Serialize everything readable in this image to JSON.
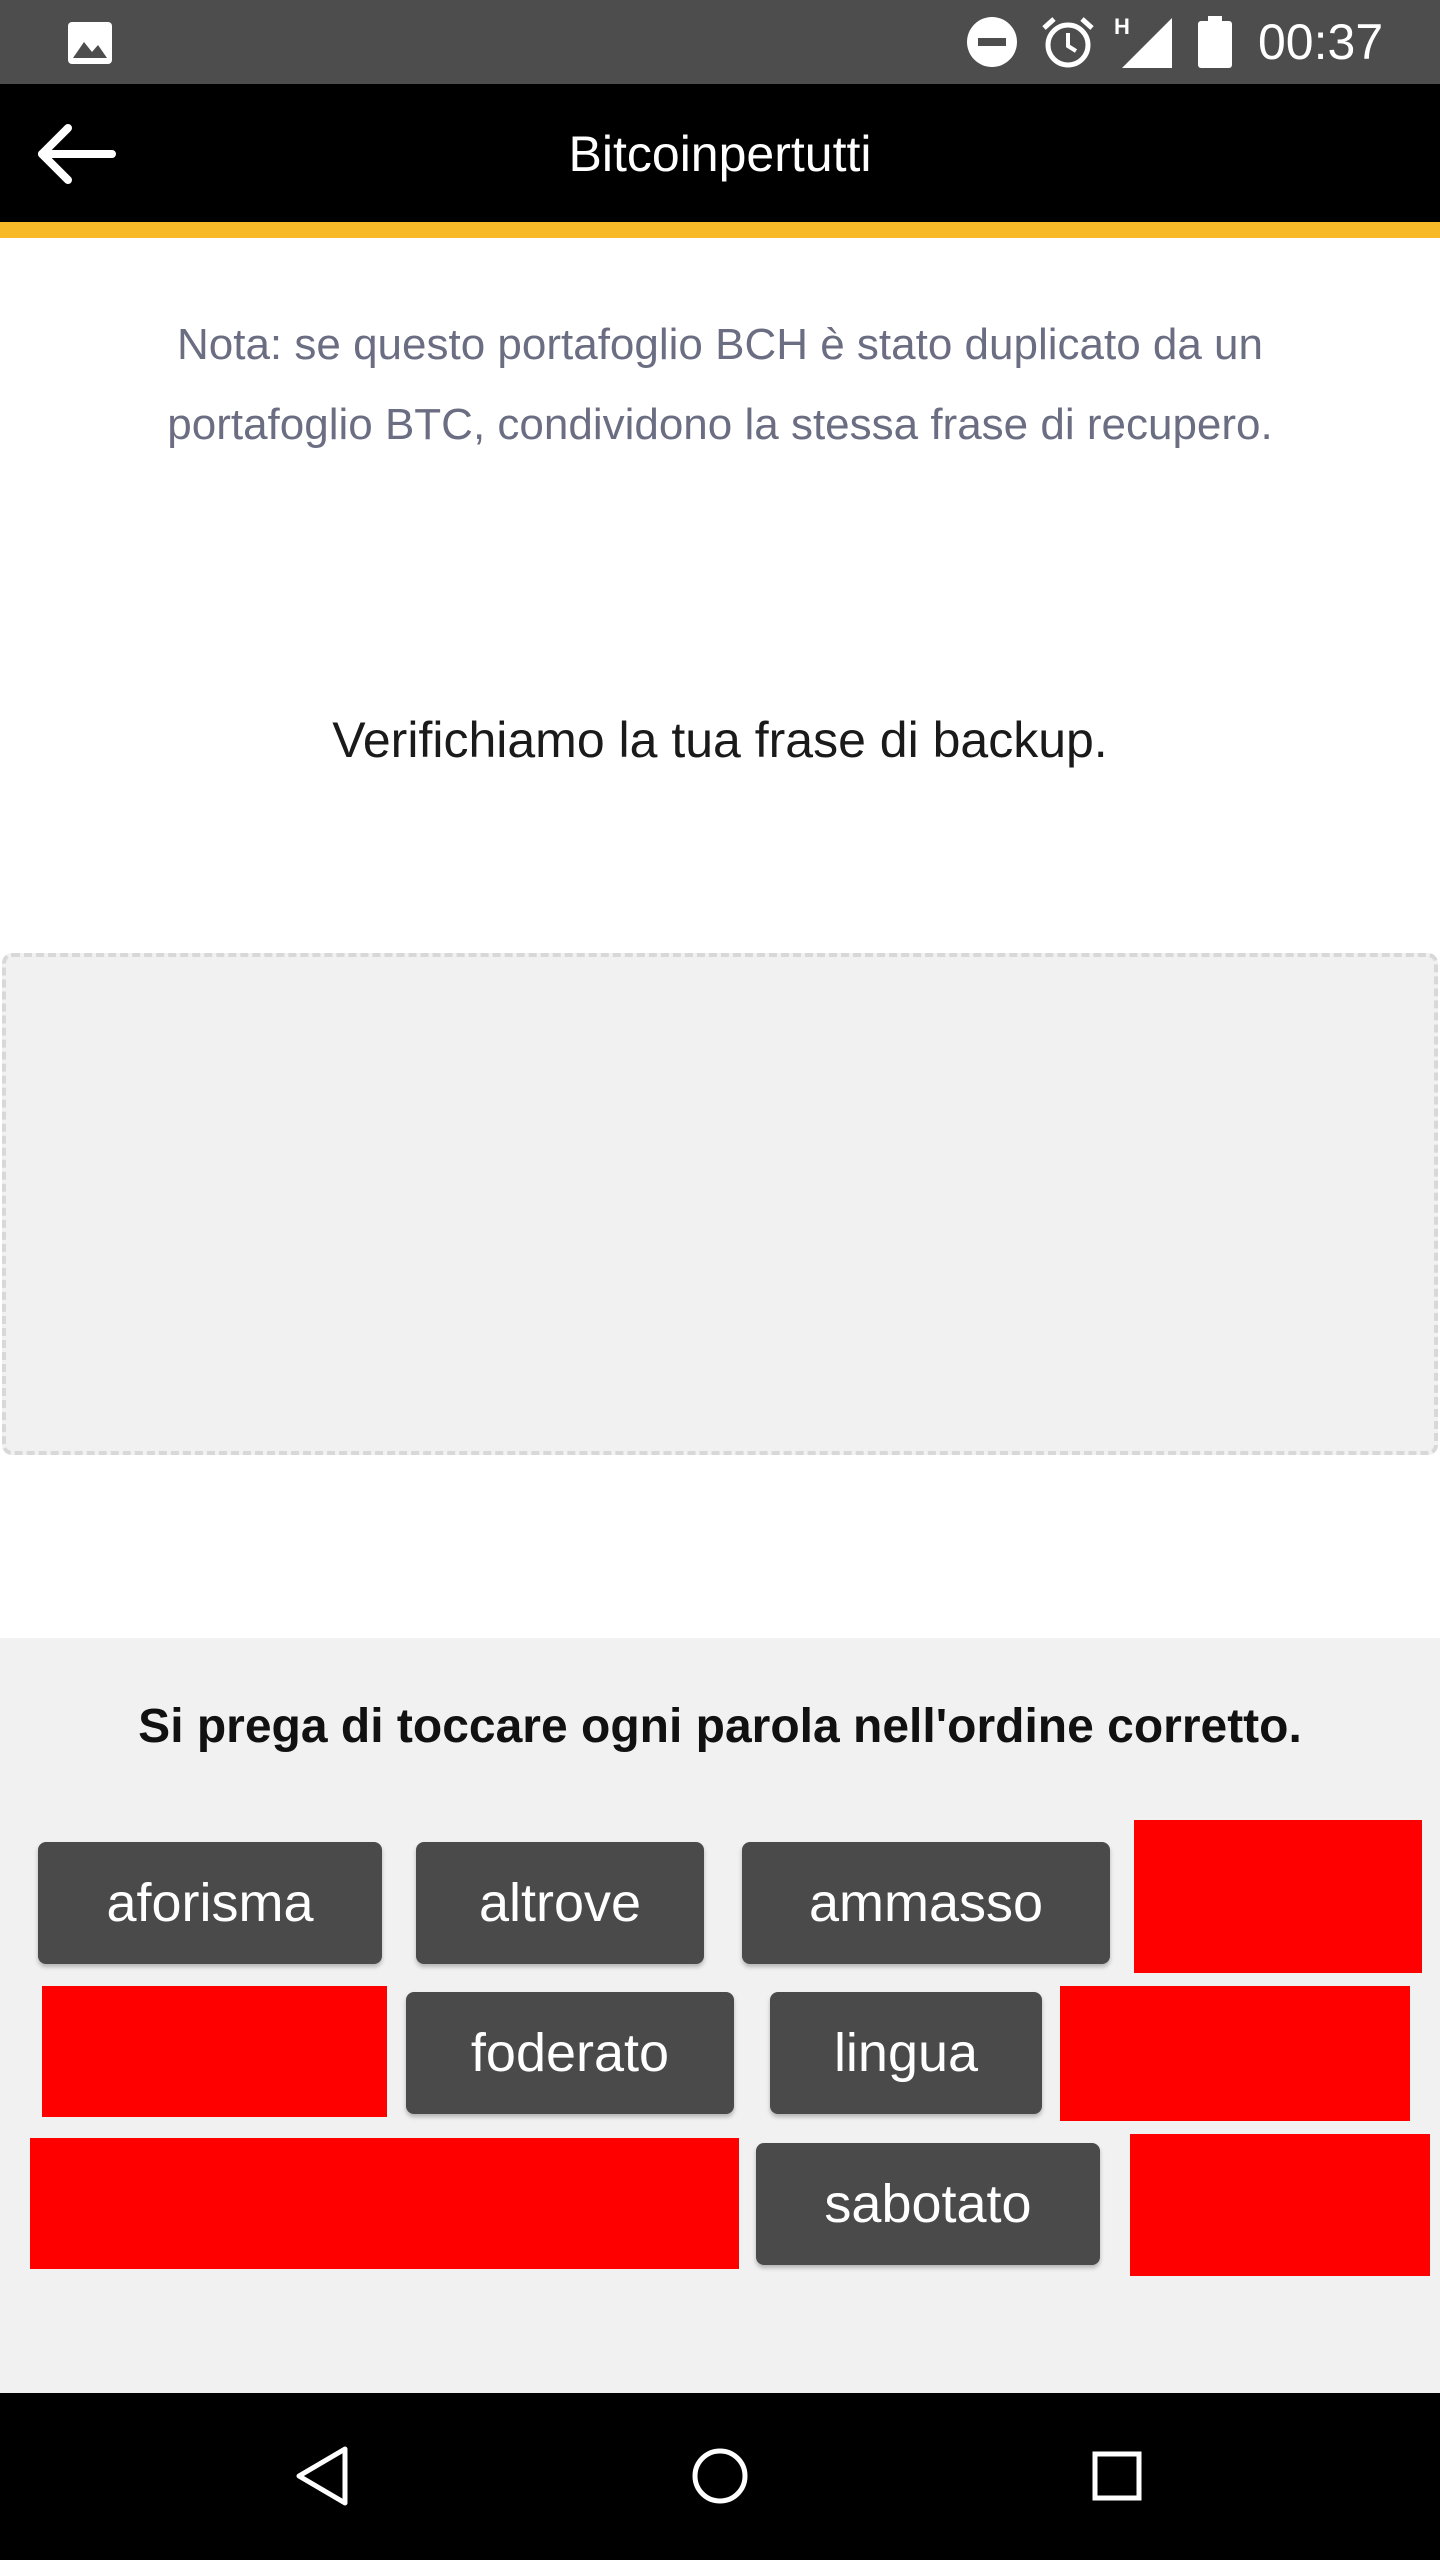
{
  "status_bar": {
    "time": "00:37",
    "network_type": "H",
    "icons": [
      "gallery-icon",
      "do-not-disturb-icon",
      "alarm-icon",
      "signal-icon",
      "battery-icon"
    ]
  },
  "app_bar": {
    "title": "Bitcoinpertutti",
    "back_icon": "arrow-left-icon",
    "accent_color": "#f7b928"
  },
  "content": {
    "note": "Nota: se questo portafoglio BCH è stato duplicato da un portafoglio BTC, condividono la stessa frase di recupero.",
    "heading": "Verifichiamo la tua frase di backup."
  },
  "word_panel": {
    "instruction": "Si prega di toccare ogni parola nell'ordine corretto.",
    "words": [
      "aforisma",
      "altrove",
      "ammasso",
      "foderato",
      "lingua",
      "sabotato"
    ]
  },
  "nav_bar": {
    "icons": [
      "back-triangle-icon",
      "home-circle-icon",
      "recents-square-icon"
    ]
  }
}
